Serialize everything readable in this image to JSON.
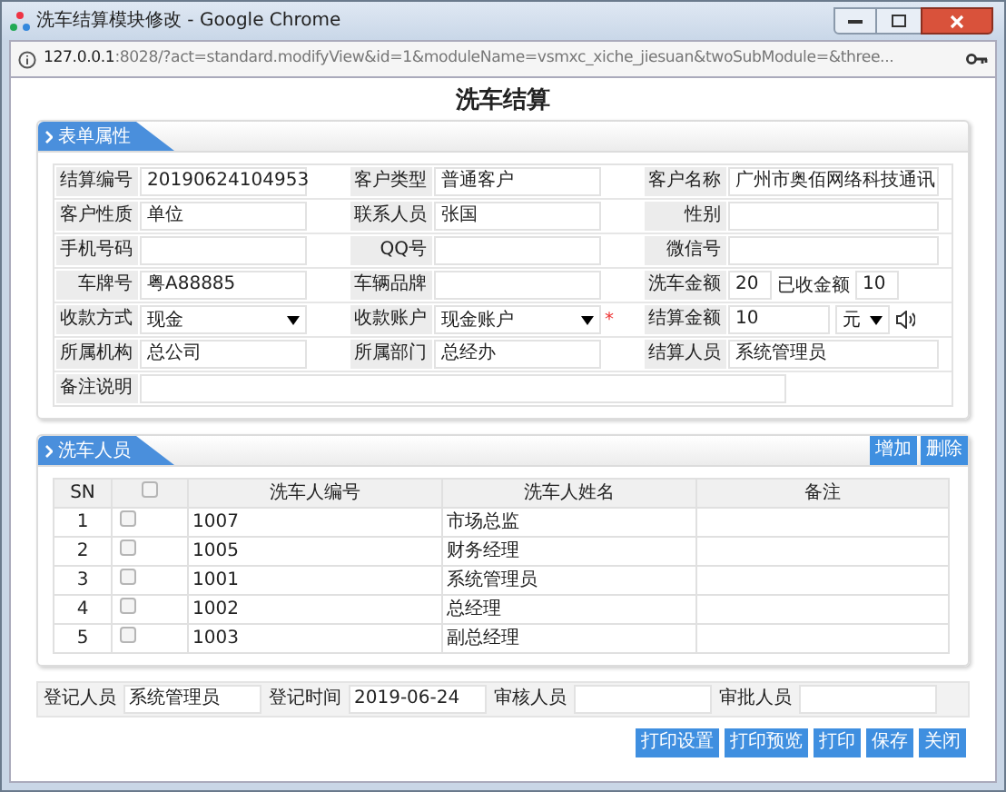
{
  "window": {
    "title": "洗车结算模块修改 - Google Chrome"
  },
  "address_bar": {
    "host": "127.0.0.1",
    "rest": ":8028/?act=standard.modifyView&id=1&moduleName=vsmxc_xiche_jiesuan&twoSubModule=&three..."
  },
  "page_title": "洗车结算",
  "form_section": {
    "title": "表单属性",
    "rows": [
      [
        {
          "kind": "text",
          "label": "结算编号",
          "value": "20190624104953"
        },
        {
          "kind": "text",
          "label": "客户类型",
          "value": "普通客户"
        },
        {
          "kind": "text",
          "label": "客户名称",
          "value": "广州市奥佰网络科技通讯"
        }
      ],
      [
        {
          "kind": "text",
          "label": "客户性质",
          "value": "单位"
        },
        {
          "kind": "text",
          "label": "联系人员",
          "value": "张国"
        },
        {
          "kind": "text",
          "label": "性别"
        }
      ],
      [
        {
          "kind": "text",
          "label": "手机号码"
        },
        {
          "kind": "text",
          "label": "QQ号"
        },
        {
          "kind": "text",
          "label": "微信号"
        }
      ],
      [
        {
          "kind": "text",
          "label": "车牌号",
          "value": "粤A88885"
        },
        {
          "kind": "text",
          "label": "车辆品牌"
        },
        {
          "kind": "split",
          "label": "洗车金额",
          "value": "20",
          "second_label": "已收金额",
          "second_value": "10"
        }
      ],
      [
        {
          "kind": "select",
          "label": "收款方式",
          "value": "现金"
        },
        {
          "kind": "select",
          "label": "收款账户",
          "value": "现金账户",
          "required_mark": "*"
        },
        {
          "kind": "amount",
          "label": "结算金额",
          "value": "10",
          "unit": "元"
        }
      ],
      [
        {
          "kind": "text",
          "label": "所属机构",
          "value": "总公司"
        },
        {
          "kind": "text",
          "label": "所属部门",
          "value": "总经办"
        },
        {
          "kind": "text",
          "label": "结算人员",
          "value": "系统管理员"
        }
      ],
      [
        {
          "kind": "wide",
          "label": "备注说明"
        }
      ]
    ]
  },
  "staff_section": {
    "title": "洗车人员",
    "actions": [
      "增加",
      "删除"
    ],
    "columns": [
      {
        "kind": "text",
        "label": "SN"
      },
      {
        "kind": "checkbox",
        "checked": false
      },
      {
        "kind": "text",
        "label": "洗车人编号"
      },
      {
        "kind": "text",
        "label": "洗车人姓名"
      },
      {
        "kind": "text",
        "label": "备注"
      }
    ],
    "rows": [
      {
        "sn": "1",
        "checked": false,
        "code": "1007",
        "name": "市场总监"
      },
      {
        "sn": "2",
        "checked": false,
        "code": "1005",
        "name": "财务经理"
      },
      {
        "sn": "3",
        "checked": false,
        "code": "1001",
        "name": "系统管理员"
      },
      {
        "sn": "4",
        "checked": false,
        "code": "1002",
        "name": "总经理"
      },
      {
        "sn": "5",
        "checked": false,
        "code": "1003",
        "name": "副总经理"
      }
    ]
  },
  "footer_fields": [
    {
      "label": "登记人员",
      "value": "系统管理员"
    },
    {
      "label": "登记时间",
      "value": "2019-06-24"
    },
    {
      "label": "审核人员"
    },
    {
      "label": "审批人员"
    }
  ],
  "buttons": [
    "打印设置",
    "打印预览",
    "打印",
    "保存",
    "关闭"
  ]
}
